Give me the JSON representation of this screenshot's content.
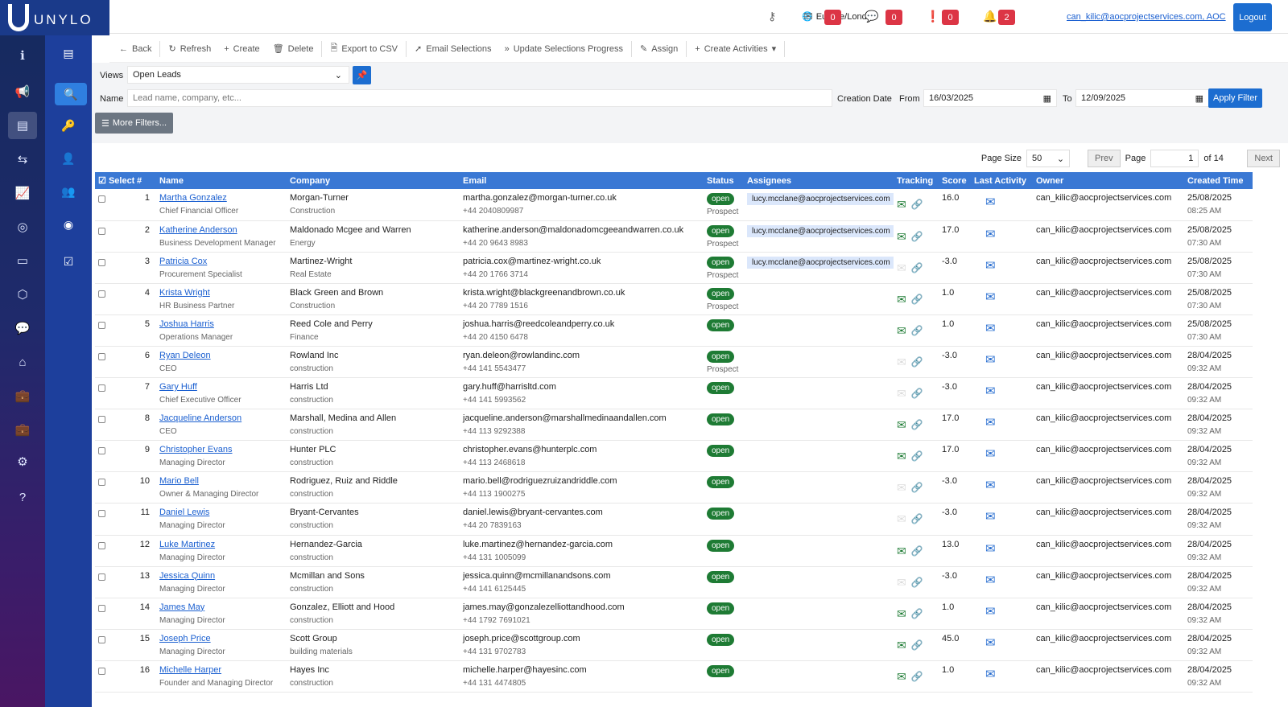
{
  "app": {
    "logo_text": "UNYLO"
  },
  "header": {
    "timezone": "Europe/London",
    "mail_count": "0",
    "chat_count": "0",
    "alert_count": "0",
    "notif_count": "2",
    "user": "can_kilic@aocprojectservices.com, AOC",
    "logout": "Logout"
  },
  "toolbar": {
    "back": "Back",
    "refresh": "Refresh",
    "create": "Create",
    "delete": "Delete",
    "export": "Export to CSV",
    "email": "Email Selections",
    "update": "Update Selections Progress",
    "assign": "Assign",
    "activities": "Create Activities"
  },
  "filters": {
    "views_label": "Views",
    "views_value": "Open Leads",
    "name_label": "Name",
    "name_placeholder": "Lead name, company, etc...",
    "creation_label": "Creation Date",
    "from_label": "From",
    "from_value": "16/03/2025",
    "to_label": "To",
    "to_value": "12/09/2025",
    "apply": "Apply Filter",
    "more": "More Filters..."
  },
  "pager": {
    "size_label": "Page Size",
    "size_value": "50",
    "prev": "Prev",
    "page_label": "Page",
    "page_value": "1",
    "of": "of 14",
    "next": "Next"
  },
  "columns": [
    "Select",
    "#",
    "Name",
    "Company",
    "Email",
    "Status",
    "Assignees",
    "Tracking",
    "Score",
    "Last Activity",
    "Owner",
    "Created Time"
  ],
  "rows": [
    {
      "n": "1",
      "name": "Martha Gonzalez",
      "title": "Chief Financial Officer",
      "company": "Morgan-Turner",
      "industry": "Construction",
      "email": "martha.gonzalez@morgan-turner.co.uk",
      "phone": "+44 2040809987",
      "status": "open",
      "stage": "Prospect",
      "assignee": "lucy.mcclane@aocprojectservices.com",
      "email_on": true,
      "link_on": true,
      "score": "16.0",
      "owner": "can_kilic@aocprojectservices.com",
      "date": "25/08/2025",
      "time": "08:25 AM"
    },
    {
      "n": "2",
      "name": "Katherine Anderson",
      "title": "Business Development Manager",
      "company": "Maldonado Mcgee and Warren",
      "industry": "Energy",
      "email": "katherine.anderson@maldonadomcgeeandwarren.co.uk",
      "phone": "+44 20 9643 8983",
      "status": "open",
      "stage": "Prospect",
      "assignee": "lucy.mcclane@aocprojectservices.com",
      "email_on": true,
      "link_on": true,
      "score": "17.0",
      "owner": "can_kilic@aocprojectservices.com",
      "date": "25/08/2025",
      "time": "07:30 AM"
    },
    {
      "n": "3",
      "name": "Patricia Cox",
      "title": "Procurement Specialist",
      "company": "Martinez-Wright",
      "industry": "Real Estate",
      "email": "patricia.cox@martinez-wright.co.uk",
      "phone": "+44 20 1766 3714",
      "status": "open",
      "stage": "Prospect",
      "assignee": "lucy.mcclane@aocprojectservices.com",
      "email_on": false,
      "link_on": false,
      "score": "-3.0",
      "owner": "can_kilic@aocprojectservices.com",
      "date": "25/08/2025",
      "time": "07:30 AM"
    },
    {
      "n": "4",
      "name": "Krista Wright",
      "title": "HR Business Partner",
      "company": "Black Green and Brown",
      "industry": "Construction",
      "email": "krista.wright@blackgreenandbrown.co.uk",
      "phone": "+44 20 7789 1516",
      "status": "open",
      "stage": "Prospect",
      "assignee": "",
      "email_on": true,
      "link_on": false,
      "score": "1.0",
      "owner": "can_kilic@aocprojectservices.com",
      "date": "25/08/2025",
      "time": "07:30 AM"
    },
    {
      "n": "5",
      "name": "Joshua Harris",
      "title": "Operations Manager",
      "company": "Reed Cole and Perry",
      "industry": "Finance",
      "email": "joshua.harris@reedcoleandperry.co.uk",
      "phone": "+44 20 4150 6478",
      "status": "open",
      "stage": "",
      "assignee": "",
      "email_on": true,
      "link_on": false,
      "score": "1.0",
      "owner": "can_kilic@aocprojectservices.com",
      "date": "25/08/2025",
      "time": "07:30 AM"
    },
    {
      "n": "6",
      "name": "Ryan Deleon",
      "title": "CEO",
      "company": "Rowland Inc",
      "industry": "construction",
      "email": "ryan.deleon@rowlandinc.com",
      "phone": "+44 141 5543477",
      "status": "open",
      "stage": "Prospect",
      "assignee": "",
      "email_on": false,
      "link_on": false,
      "score": "-3.0",
      "owner": "can_kilic@aocprojectservices.com",
      "date": "28/04/2025",
      "time": "09:32 AM"
    },
    {
      "n": "7",
      "name": "Gary Huff",
      "title": "Chief Executive Officer",
      "company": "Harris Ltd",
      "industry": "construction",
      "email": "gary.huff@harrisltd.com",
      "phone": "+44 141 5993562",
      "status": "open",
      "stage": "",
      "assignee": "",
      "email_on": false,
      "link_on": false,
      "score": "-3.0",
      "owner": "can_kilic@aocprojectservices.com",
      "date": "28/04/2025",
      "time": "09:32 AM"
    },
    {
      "n": "8",
      "name": "Jacqueline Anderson",
      "title": "CEO",
      "company": "Marshall, Medina and Allen",
      "industry": "construction",
      "email": "jacqueline.anderson@marshallmedinaandallen.com",
      "phone": "+44 113 9292388",
      "status": "open",
      "stage": "",
      "assignee": "",
      "email_on": true,
      "link_on": true,
      "score": "17.0",
      "owner": "can_kilic@aocprojectservices.com",
      "date": "28/04/2025",
      "time": "09:32 AM"
    },
    {
      "n": "9",
      "name": "Christopher Evans",
      "title": "Managing Director",
      "company": "Hunter PLC",
      "industry": "construction",
      "email": "christopher.evans@hunterplc.com",
      "phone": "+44 113 2468618",
      "status": "open",
      "stage": "",
      "assignee": "",
      "email_on": true,
      "link_on": true,
      "score": "17.0",
      "owner": "can_kilic@aocprojectservices.com",
      "date": "28/04/2025",
      "time": "09:32 AM"
    },
    {
      "n": "10",
      "name": "Mario Bell",
      "title": "Owner & Managing Director",
      "company": "Rodriguez, Ruiz and Riddle",
      "industry": "construction",
      "email": "mario.bell@rodriguezruizandriddle.com",
      "phone": "+44 113 1900275",
      "status": "open",
      "stage": "",
      "assignee": "",
      "email_on": false,
      "link_on": false,
      "score": "-3.0",
      "owner": "can_kilic@aocprojectservices.com",
      "date": "28/04/2025",
      "time": "09:32 AM"
    },
    {
      "n": "11",
      "name": "Daniel Lewis",
      "title": "Managing Director",
      "company": "Bryant-Cervantes",
      "industry": "construction",
      "email": "daniel.lewis@bryant-cervantes.com",
      "phone": "+44 20 7839163",
      "status": "open",
      "stage": "",
      "assignee": "",
      "email_on": false,
      "link_on": false,
      "score": "-3.0",
      "owner": "can_kilic@aocprojectservices.com",
      "date": "28/04/2025",
      "time": "09:32 AM"
    },
    {
      "n": "12",
      "name": "Luke Martinez",
      "title": "Managing Director",
      "company": "Hernandez-Garcia",
      "industry": "construction",
      "email": "luke.martinez@hernandez-garcia.com",
      "phone": "+44 131 1005099",
      "status": "open",
      "stage": "",
      "assignee": "",
      "email_on": true,
      "link_on": true,
      "score": "13.0",
      "owner": "can_kilic@aocprojectservices.com",
      "date": "28/04/2025",
      "time": "09:32 AM"
    },
    {
      "n": "13",
      "name": "Jessica Quinn",
      "title": "Managing Director",
      "company": "Mcmillan and Sons",
      "industry": "construction",
      "email": "jessica.quinn@mcmillanandsons.com",
      "phone": "+44 141 6125445",
      "status": "open",
      "stage": "",
      "assignee": "",
      "email_on": false,
      "link_on": false,
      "score": "-3.0",
      "owner": "can_kilic@aocprojectservices.com",
      "date": "28/04/2025",
      "time": "09:32 AM"
    },
    {
      "n": "14",
      "name": "James May",
      "title": "Managing Director",
      "company": "Gonzalez, Elliott and Hood",
      "industry": "construction",
      "email": "james.may@gonzalezelliottandhood.com",
      "phone": "+44 1792 7691021",
      "status": "open",
      "stage": "",
      "assignee": "",
      "email_on": true,
      "link_on": false,
      "score": "1.0",
      "owner": "can_kilic@aocprojectservices.com",
      "date": "28/04/2025",
      "time": "09:32 AM"
    },
    {
      "n": "15",
      "name": "Joseph Price",
      "title": "Managing Director",
      "company": "Scott Group",
      "industry": "building materials",
      "email": "joseph.price@scottgroup.com",
      "phone": "+44 131 9702783",
      "status": "open",
      "stage": "",
      "assignee": "",
      "email_on": true,
      "link_on": true,
      "score": "45.0",
      "owner": "can_kilic@aocprojectservices.com",
      "date": "28/04/2025",
      "time": "09:32 AM"
    },
    {
      "n": "16",
      "name": "Michelle Harper",
      "title": "Founder and Managing Director",
      "company": "Hayes Inc",
      "industry": "construction",
      "email": "michelle.harper@hayesinc.com",
      "phone": "+44 131 4474805",
      "status": "open",
      "stage": "",
      "assignee": "",
      "email_on": true,
      "link_on": false,
      "score": "1.0",
      "owner": "can_kilic@aocprojectservices.com",
      "date": "28/04/2025",
      "time": "09:32 AM"
    }
  ]
}
